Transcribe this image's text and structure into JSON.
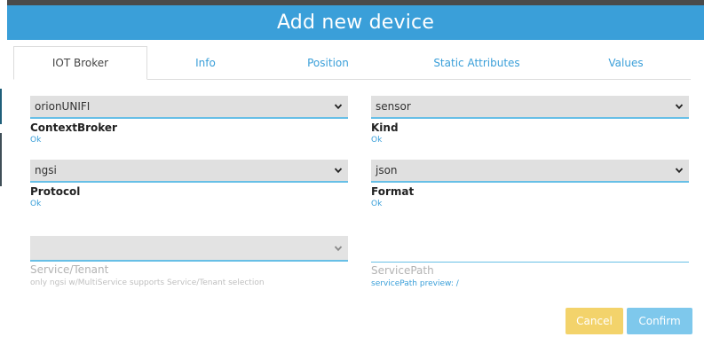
{
  "dialog": {
    "title": "Add new device"
  },
  "tabs": [
    {
      "label": "IOT Broker",
      "active": true
    },
    {
      "label": "Info",
      "active": false
    },
    {
      "label": "Position",
      "active": false
    },
    {
      "label": "Static Attributes",
      "active": false
    },
    {
      "label": "Values",
      "active": false
    }
  ],
  "fields": {
    "context_broker": {
      "value": "orionUNIFI",
      "label": "ContextBroker",
      "status": "Ok"
    },
    "kind": {
      "value": "sensor",
      "label": "Kind",
      "status": "Ok"
    },
    "protocol": {
      "value": "ngsi",
      "label": "Protocol",
      "status": "Ok"
    },
    "format": {
      "value": "json",
      "label": "Format",
      "status": "Ok"
    },
    "service_tenant": {
      "value": "",
      "label": "Service/Tenant",
      "hint": "only ngsi w/MultiService supports Service/Tenant selection"
    },
    "service_path": {
      "value": "",
      "label": "ServicePath",
      "preview": "servicePath preview: /"
    }
  },
  "buttons": {
    "cancel": "Cancel",
    "confirm": "Confirm"
  },
  "colors": {
    "accent": "#3a9fd9",
    "cancel": "#f3d36b",
    "confirm": "#7ec8ec"
  }
}
